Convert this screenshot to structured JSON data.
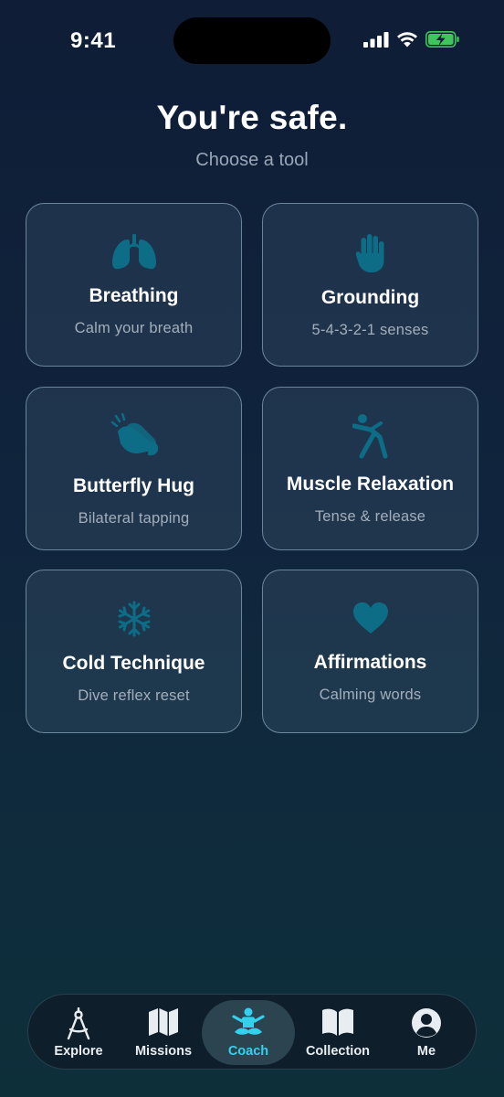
{
  "status_bar": {
    "time": "9:41"
  },
  "header": {
    "title": "You're safe.",
    "subtitle": "Choose a tool"
  },
  "tools": [
    {
      "title": "Breathing",
      "desc": "Calm your breath",
      "icon": "lungs-icon"
    },
    {
      "title": "Grounding",
      "desc": "5-4-3-2-1 senses",
      "icon": "hand-icon"
    },
    {
      "title": "Butterfly Hug",
      "desc": "Bilateral tapping",
      "icon": "clapping-hands-icon"
    },
    {
      "title": "Muscle Relaxation",
      "desc": "Tense & release",
      "icon": "stretching-figure-icon"
    },
    {
      "title": "Cold Technique",
      "desc": "Dive reflex reset",
      "icon": "snowflake-icon"
    },
    {
      "title": "Affirmations",
      "desc": "Calming words",
      "icon": "heart-icon"
    }
  ],
  "tabbar": {
    "items": [
      {
        "label": "Explore",
        "icon": "compass-icon"
      },
      {
        "label": "Missions",
        "icon": "map-icon"
      },
      {
        "label": "Coach",
        "icon": "meditation-icon",
        "active": true
      },
      {
        "label": "Collection",
        "icon": "book-icon"
      },
      {
        "label": "Me",
        "icon": "person-icon"
      }
    ]
  },
  "colors": {
    "accent": "#34d1ef",
    "icon_teal": "#0e6d86",
    "background_top": "#0f1d36",
    "background_bottom": "#0d2f3a"
  }
}
